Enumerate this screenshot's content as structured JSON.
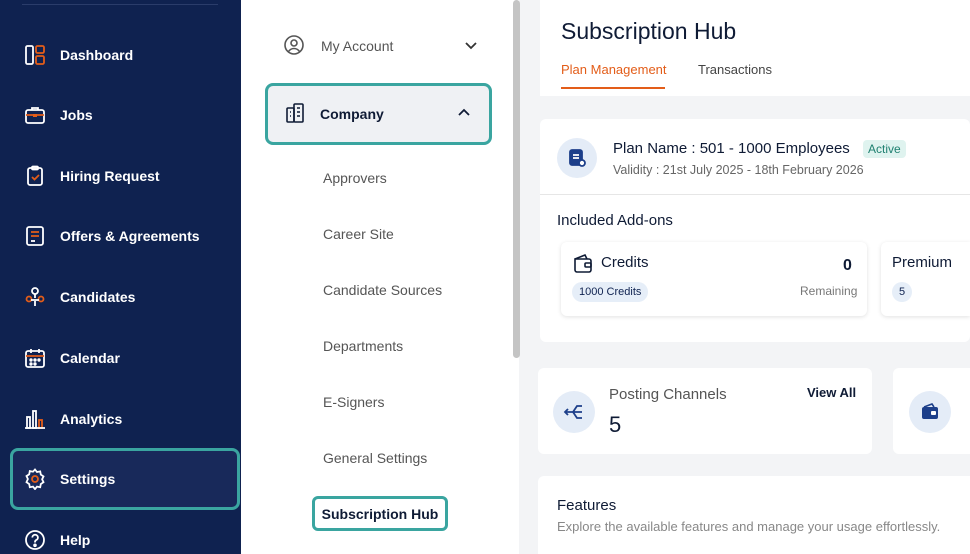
{
  "sidebar": {
    "items": [
      {
        "label": "Dashboard",
        "icon": "dashboard-icon"
      },
      {
        "label": "Jobs",
        "icon": "briefcase-icon"
      },
      {
        "label": "Hiring Request",
        "icon": "clipboard-icon"
      },
      {
        "label": "Offers & Agreements",
        "icon": "document-icon"
      },
      {
        "label": "Candidates",
        "icon": "people-icon"
      },
      {
        "label": "Calendar",
        "icon": "calendar-icon"
      },
      {
        "label": "Analytics",
        "icon": "analytics-icon"
      },
      {
        "label": "Settings",
        "icon": "gear-icon"
      },
      {
        "label": "Help",
        "icon": "help-icon"
      }
    ]
  },
  "submenu": {
    "account_label": "My Account",
    "company_label": "Company",
    "links": [
      "Approvers",
      "Career Site",
      "Candidate Sources",
      "Departments",
      "E-Signers",
      "General Settings"
    ],
    "active_link": "Subscription Hub"
  },
  "main": {
    "title": "Subscription Hub",
    "tabs": [
      {
        "label": "Plan Management"
      },
      {
        "label": "Transactions"
      }
    ],
    "plan": {
      "name": "Plan Name : 501 - 1000 Employees",
      "status": "Active",
      "validity": "Validity : 21st July 2025 - 18th February 2026"
    },
    "addons_title": "Included Add-ons",
    "addons": [
      {
        "name": "Credits",
        "count": "0",
        "count_label": "Remaining",
        "pill": "1000 Credits"
      },
      {
        "name": "Premium",
        "pill": "5"
      }
    ],
    "posting": {
      "label": "Posting Channels",
      "count": "5",
      "view_all": "View All"
    },
    "features": {
      "title": "Features",
      "subtitle": "Explore the available features and manage your usage effortlessly."
    }
  },
  "colors": {
    "sidebar_bg": "#0f2250",
    "accent_orange": "#e35d19",
    "highlight_teal": "#3aa5a0"
  }
}
